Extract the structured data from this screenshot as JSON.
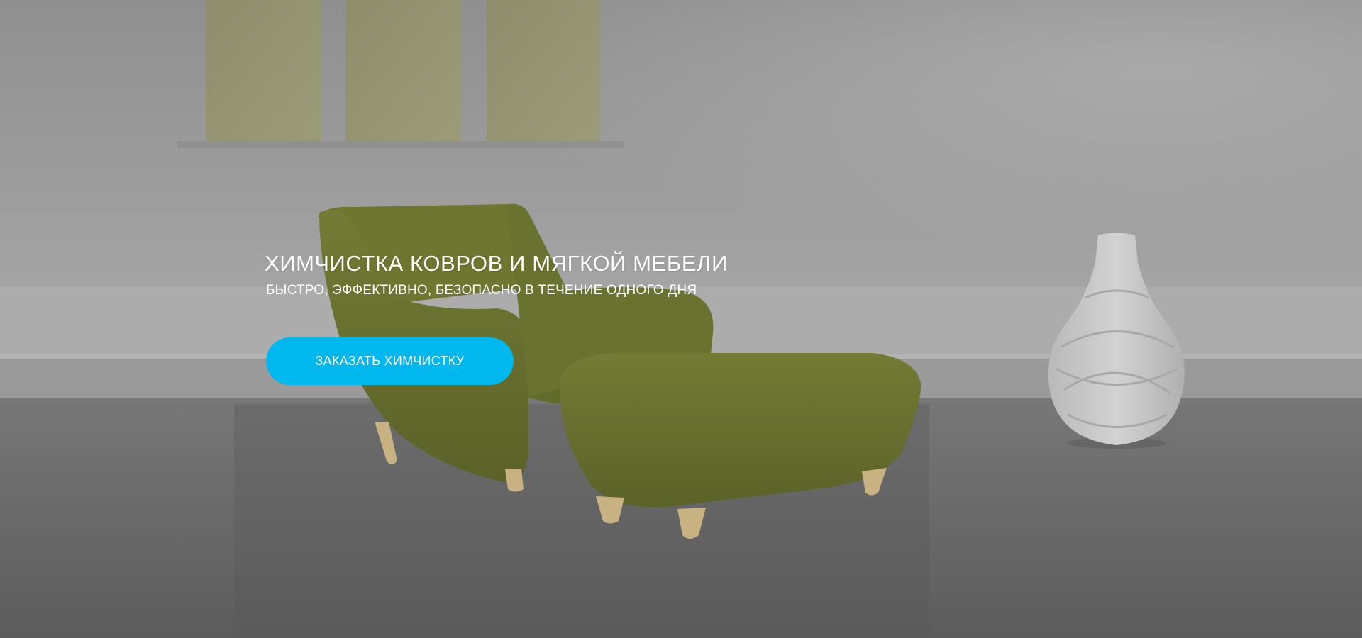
{
  "hero": {
    "title": "ХИМЧИСТКА КОВРОВ И МЯГКОЙ МЕБЕЛИ",
    "subtitle": "БЫСТРО, ЭФФЕКТИВНО, БЕЗОПАСНО В ТЕЧЕНИЕ ОДНОГО ДНЯ",
    "cta_label": "ЗАКАЗАТЬ ХИМЧИСТКУ"
  },
  "colors": {
    "accent": "#00b8ee",
    "text": "#ffffff",
    "armchair": "#6b7431",
    "wall": "#a6a6a6",
    "floor": "#6e6e6e"
  }
}
